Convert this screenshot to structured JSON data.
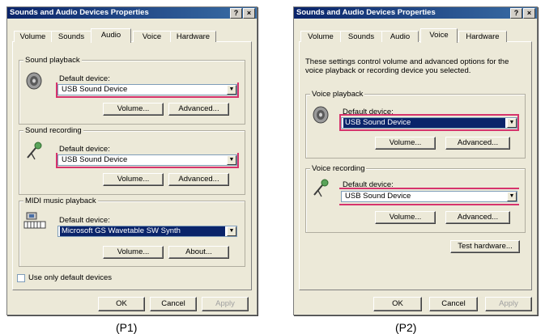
{
  "dialog1": {
    "title": "Sounds and Audio Devices Properties",
    "title_buttons": [
      "?",
      "×"
    ],
    "tabs": [
      "Volume",
      "Sounds",
      "Audio",
      "Voice",
      "Hardware"
    ],
    "active_tab": "Audio",
    "sound_playback": {
      "group": "Sound playback",
      "label": "Default device:",
      "value": "USB Sound Device",
      "volume": "Volume...",
      "advanced": "Advanced..."
    },
    "sound_recording": {
      "group": "Sound recording",
      "label": "Default device:",
      "value": "USB Sound Device",
      "volume": "Volume...",
      "advanced": "Advanced..."
    },
    "midi": {
      "group": "MIDI music playback",
      "label": "Default device:",
      "value": "Microsoft GS Wavetable SW Synth",
      "volume": "Volume...",
      "about": "About..."
    },
    "use_default": "Use only default devices",
    "ok": "OK",
    "cancel": "Cancel",
    "apply": "Apply",
    "caption": "(P1)"
  },
  "dialog2": {
    "title": "Sounds and Audio Devices Properties",
    "title_buttons": [
      "?",
      "×"
    ],
    "tabs": [
      "Volume",
      "Sounds",
      "Audio",
      "Voice",
      "Hardware"
    ],
    "active_tab": "Voice",
    "description": "These settings control volume and advanced options for the voice playback or recording device you selected.",
    "voice_playback": {
      "group": "Voice playback",
      "label": "Default device:",
      "value": "USB Sound Device",
      "volume": "Volume...",
      "advanced": "Advanced..."
    },
    "voice_recording": {
      "group": "Voice recording",
      "label": "Default device:",
      "value": "USB Sound Device",
      "volume": "Volume...",
      "advanced": "Advanced..."
    },
    "test_hardware": "Test hardware...",
    "ok": "OK",
    "cancel": "Cancel",
    "apply": "Apply",
    "caption": "(P2)"
  },
  "colors": {
    "highlight": "#d6336c",
    "selection": "#0a246a",
    "titlebar": "#0a246a"
  }
}
